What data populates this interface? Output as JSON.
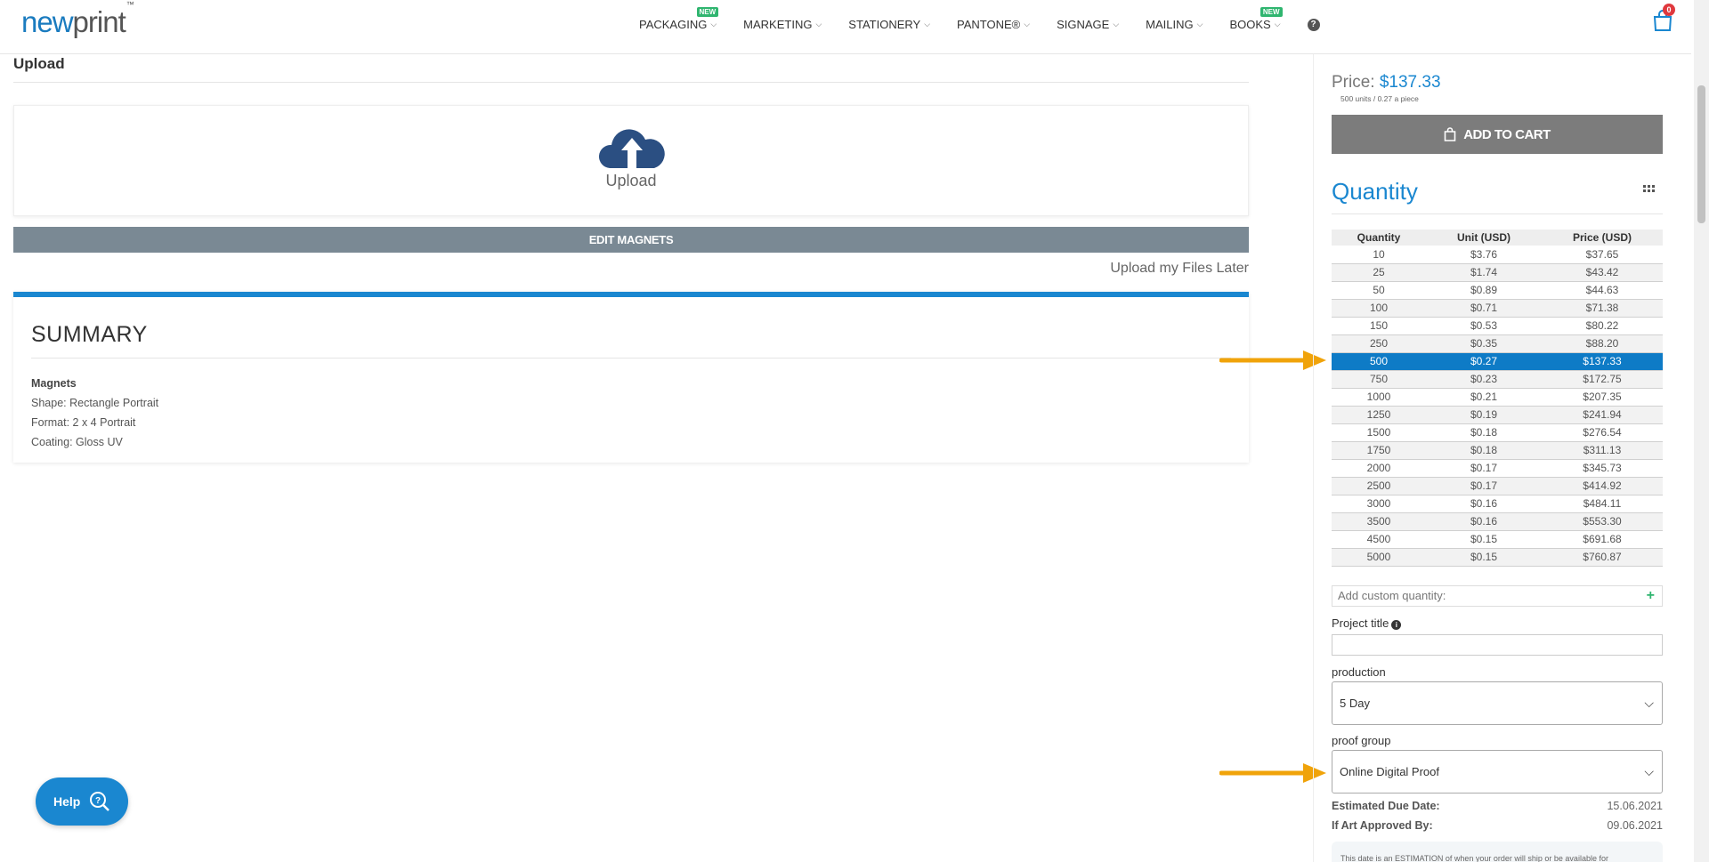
{
  "header": {
    "logo_new": "new",
    "logo_print": "print",
    "logo_tm": "™",
    "nav": [
      {
        "label": "PACKAGING",
        "badge": "NEW"
      },
      {
        "label": "MARKETING",
        "badge": ""
      },
      {
        "label": "STATIONERY",
        "badge": ""
      },
      {
        "label": "PANTONE®",
        "badge": ""
      },
      {
        "label": "SIGNAGE",
        "badge": ""
      },
      {
        "label": "MAILING",
        "badge": ""
      },
      {
        "label": "BOOKS",
        "badge": "NEW"
      }
    ],
    "help_icon": "question-circle-icon",
    "cart_count": "0"
  },
  "main": {
    "upload_title": "Upload",
    "upload_label": "Upload",
    "edit_button": "EDIT MAGNETS",
    "upload_later": "Upload my Files Later",
    "summary": {
      "title": "SUMMARY",
      "product": "Magnets",
      "lines": [
        "Shape: Rectangle Portrait",
        "Format: 2 x 4 Portrait",
        "Coating: Gloss UV"
      ]
    }
  },
  "help_button": {
    "label": "Help"
  },
  "sidebar": {
    "price_label": "Price:",
    "price_value": "$137.33",
    "price_sub": "500 units / 0.27 a piece",
    "add_to_cart": "ADD TO CART",
    "quantity_title": "Quantity",
    "table": {
      "headers": [
        "Quantity",
        "Unit (USD)",
        "Price (USD)"
      ],
      "selected_index": 6,
      "rows": [
        [
          "10",
          "$3.76",
          "$37.65"
        ],
        [
          "25",
          "$1.74",
          "$43.42"
        ],
        [
          "50",
          "$0.89",
          "$44.63"
        ],
        [
          "100",
          "$0.71",
          "$71.38"
        ],
        [
          "150",
          "$0.53",
          "$80.22"
        ],
        [
          "250",
          "$0.35",
          "$88.20"
        ],
        [
          "500",
          "$0.27",
          "$137.33"
        ],
        [
          "750",
          "$0.23",
          "$172.75"
        ],
        [
          "1000",
          "$0.21",
          "$207.35"
        ],
        [
          "1250",
          "$0.19",
          "$241.94"
        ],
        [
          "1500",
          "$0.18",
          "$276.54"
        ],
        [
          "1750",
          "$0.18",
          "$311.13"
        ],
        [
          "2000",
          "$0.17",
          "$345.73"
        ],
        [
          "2500",
          "$0.17",
          "$414.92"
        ],
        [
          "3000",
          "$0.16",
          "$484.11"
        ],
        [
          "3500",
          "$0.16",
          "$553.30"
        ],
        [
          "4500",
          "$0.15",
          "$691.68"
        ],
        [
          "5000",
          "$0.15",
          "$760.87"
        ]
      ]
    },
    "custom_qty_placeholder": "Add custom quantity:",
    "project_title_label": "Project title",
    "production_label": "production",
    "production_value": "5 Day",
    "proof_label": "proof group",
    "proof_value": "Online Digital Proof",
    "due_label": "Estimated Due Date:",
    "due_value": "15.06.2021",
    "approved_label": "If Art Approved By:",
    "approved_value": "09.06.2021",
    "note": "This date is an ESTIMATION of when your order will ship or be available for"
  },
  "colors": {
    "accent": "#1a87d0",
    "selected_row": "#0e7bc6",
    "arrow": "#f0a30a",
    "badge_new": "#2fb56f"
  }
}
